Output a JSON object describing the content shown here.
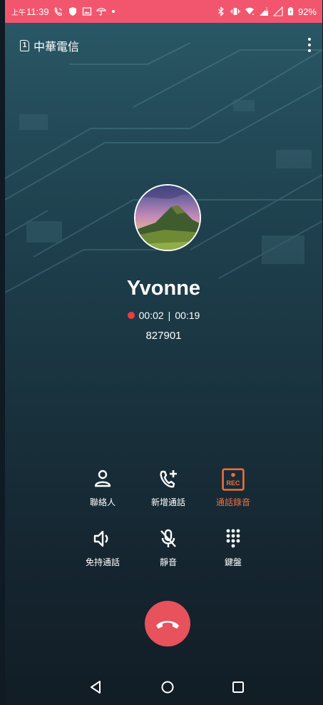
{
  "status_bar": {
    "ampm": "上午",
    "time": "11:39",
    "battery": "92%",
    "color": "#f2566e"
  },
  "header": {
    "sim_slot": "1",
    "carrier": "中華電信"
  },
  "contact": {
    "name": "Yvonne",
    "call_duration": "00:02",
    "separator": "|",
    "record_duration": "00:19",
    "number": "827901"
  },
  "controls": {
    "contacts_label": "聯絡人",
    "add_call_label": "新增通話",
    "record_label": "通話錄音",
    "record_badge": "REC",
    "speaker_label": "免持通話",
    "mute_label": "靜音",
    "keypad_label": "鍵盤"
  },
  "colors": {
    "accent_record": "#f46d3d",
    "end_call": "#e8525c",
    "recording_dot": "#ee3d3f"
  },
  "icons": {
    "status_left": [
      "wifi-calling-icon",
      "shield-icon",
      "image-icon",
      "umbrella-icon"
    ],
    "status_right": [
      "bluetooth-icon",
      "vibrate-icon",
      "wifi-icon",
      "signal-icon",
      "battery-icon"
    ],
    "nav": [
      "back-icon",
      "home-icon",
      "recents-icon"
    ]
  }
}
